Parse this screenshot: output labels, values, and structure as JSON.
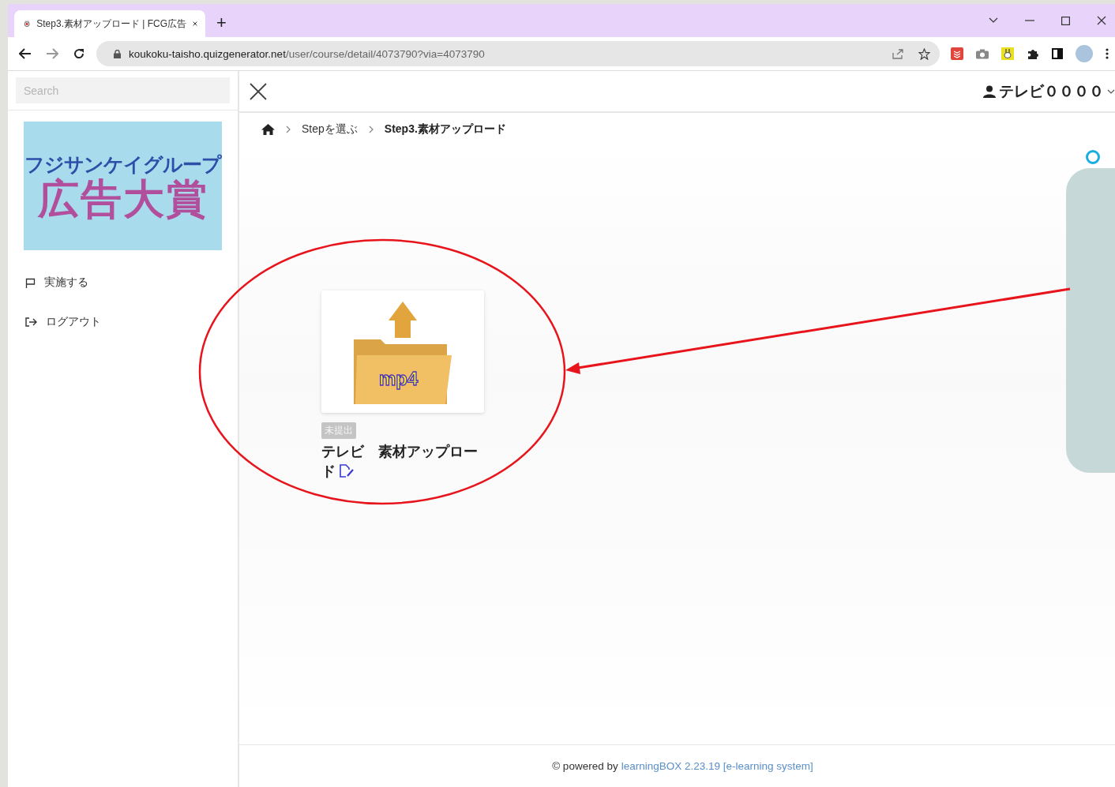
{
  "browser": {
    "tab": {
      "title": "Step3.素材アップロード | FCG広告",
      "selected": true
    },
    "new_tab": "+",
    "url": {
      "host": "koukoku-taisho.quizgenerator.net",
      "path": "/user/course/detail/4073790?via=4073790"
    }
  },
  "sidebar": {
    "search": {
      "placeholder": "Search"
    },
    "logo": {
      "line_1": "フジサンケイグループ",
      "line_2": "広告大賞"
    },
    "items": [
      {
        "kind": "flag",
        "label": "実施する"
      },
      {
        "kind": "logout",
        "label": "ログアウト"
      }
    ]
  },
  "header": {
    "user": "テレビ００００"
  },
  "breadcrumbs": [
    {
      "kind": "home"
    },
    {
      "kind": "link",
      "label": "Stepを選ぶ"
    },
    {
      "kind": "current",
      "label": "Step3.素材アップロード"
    }
  ],
  "card": {
    "image_label": "mp4",
    "status": "未提出",
    "title": "テレビ　素材アップロード"
  },
  "footer": {
    "prefix": "© powered by",
    "link": "learningBOX 2.23.19 [e-learning system]"
  }
}
